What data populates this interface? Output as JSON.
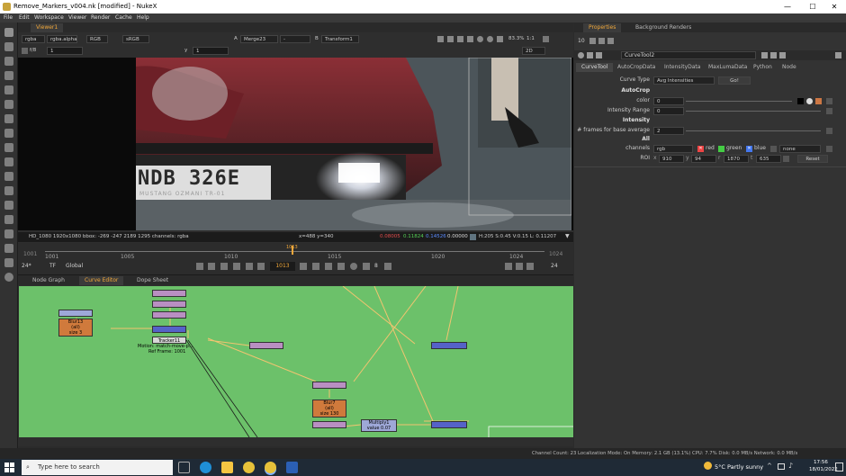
{
  "window": {
    "title": "Remove_Markers_v004.nk [modified] - NukeX",
    "minimize": "—",
    "maximize": "☐",
    "close": "✕"
  },
  "menu": [
    "File",
    "Edit",
    "Workspace",
    "Viewer",
    "Render",
    "Cache",
    "Help"
  ],
  "viewer": {
    "tab": "Viewer1",
    "channels": "rgba",
    "alpha": "rgba.alpha",
    "colorspace": "RGB",
    "lut": "sRGB",
    "a_input": "Merge23",
    "a_op": "-",
    "b_input": "Transform1",
    "fstop": "f/8",
    "frame_field": "1",
    "y_field": "1",
    "zoom": "83.3%",
    "ratio": "1:1",
    "view_mode": "2D",
    "plate_text": "NDB 326E",
    "plate_sub": "MUSTANG OZMANI TR-01",
    "status_left": "HD_1080 1920x1080  bbox: -269 -247 2189 1295 channels: rgba",
    "status_coord": "x=488 y=340",
    "status_r": "0.08005",
    "status_g": "0.11824",
    "status_b": "0.14526",
    "status_a": "0.00000",
    "status_hsv": "H:205 S:0.45 V:0.15  L: 0.11207",
    "timeline_current": "1013",
    "timeline_ticks": [
      "1001",
      "1005",
      "1010",
      "1015",
      "1020",
      "1024"
    ],
    "timeline_start": "1001",
    "timeline_end": "1024",
    "frame_display": "1013",
    "step": "8",
    "fps": "24*",
    "tf": "TF",
    "scope": "Global",
    "end_frame": "24"
  },
  "nodegraph": {
    "tabs": [
      "Node Graph",
      "Curve Editor",
      "Dope Sheet"
    ],
    "nodes": [
      {
        "label": "Blur13\n(all)\nsize 3",
        "color": "#d07a3c"
      },
      {
        "label": "Tracker11",
        "color": "#d7d7d7"
      },
      {
        "label": "Motion: match-move-p...",
        "color": "none"
      },
      {
        "label": "Ref Frame: 1001",
        "color": "none"
      },
      {
        "label": "Blur7\n(all)\nsize 130",
        "color": "#d07a3c"
      },
      {
        "label": "Multiply1\nvalue 0.07",
        "color": "#9ea8d8"
      }
    ]
  },
  "status_bar": "Channel Count: 23  Localization Mode: On  Memory: 2.1 GB (13.1%)  CPU: 7.7%  Disk: 0.0 MB/s  Network: 0.0 MB/s",
  "properties": {
    "tabs": [
      "Properties",
      "Background Renders"
    ],
    "count": "10",
    "node_name": "CurveTool2",
    "node_tabs": [
      "CurveTool",
      "AutoCropData",
      "IntensityData",
      "MaxLumaData",
      "Python",
      "Node"
    ],
    "curve_type_label": "Curve Type",
    "curve_type": "Avg Intensities",
    "go": "Go!",
    "autocrop_header": "AutoCrop",
    "color_label": "color",
    "color_value": "0",
    "intensity_range_label": "Intensity Range",
    "intensity_range_value": "0",
    "intensity_header": "Intensity",
    "frames_label": "# frames for base average",
    "frames_value": "2",
    "all_header": "All",
    "channels_label": "channels",
    "channels_value": "rgb",
    "red": "red",
    "green": "green",
    "blue": "blue",
    "none": "none",
    "roi_label": "ROI",
    "roi_x": "910",
    "roi_y": "94",
    "roi_r": "1870",
    "roi_t": "635",
    "reset": "Reset"
  },
  "taskbar": {
    "search": "Type here to search",
    "weather": "5°C  Partly sunny",
    "time": "17:56",
    "date": "18/01/2022"
  }
}
